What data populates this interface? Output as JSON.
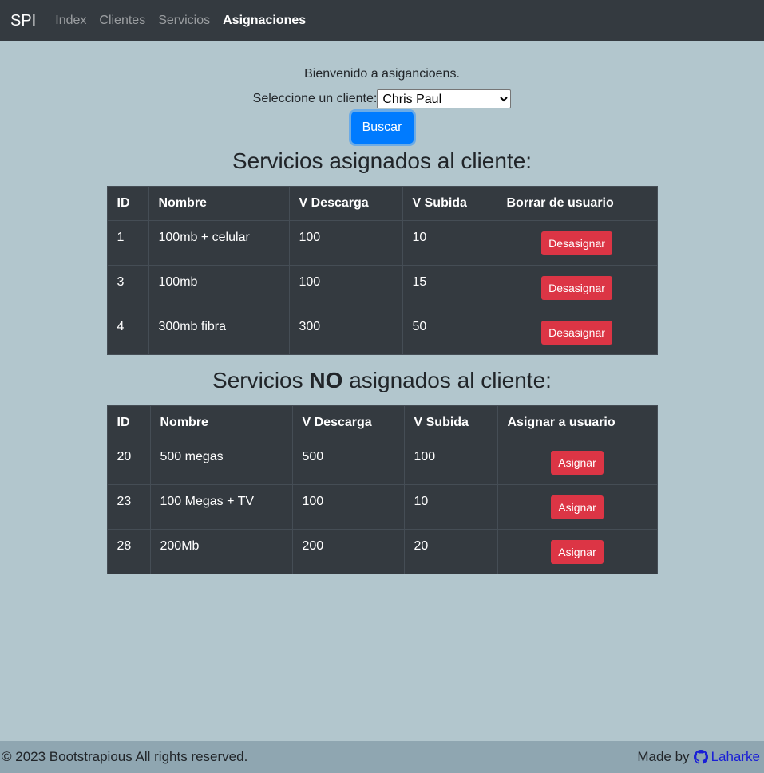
{
  "navbar": {
    "brand": "SPI",
    "links": [
      "Index",
      "Clientes",
      "Servicios",
      "Asignaciones"
    ],
    "active": "Asignaciones"
  },
  "main": {
    "welcome": "Bienvenido a asigancioens.",
    "select_label": "Seleccione un cliente:",
    "select_value": "Chris Paul",
    "search_button": "Buscar"
  },
  "assigned": {
    "heading": "Servicios asignados al cliente:",
    "columns": [
      "ID",
      "Nombre",
      "V Descarga",
      "V Subida",
      "Borrar de usuario"
    ],
    "action_label": "Desasignar",
    "rows": [
      {
        "id": "1",
        "nombre": "100mb + celular",
        "descarga": "100",
        "subida": "10"
      },
      {
        "id": "3",
        "nombre": "100mb",
        "descarga": "100",
        "subida": "15"
      },
      {
        "id": "4",
        "nombre": "300mb fibra",
        "descarga": "300",
        "subida": "50"
      }
    ]
  },
  "unassigned": {
    "heading_pre": "Servicios ",
    "heading_bold": "NO",
    "heading_post": " asignados al cliente:",
    "columns": [
      "ID",
      "Nombre",
      "V Descarga",
      "V Subida",
      "Asignar a usuario"
    ],
    "action_label": "Asignar",
    "rows": [
      {
        "id": "20",
        "nombre": "500 megas",
        "descarga": "500",
        "subida": "100"
      },
      {
        "id": "23",
        "nombre": "100 Megas + TV",
        "descarga": "100",
        "subida": "10"
      },
      {
        "id": "28",
        "nombre": "200Mb",
        "descarga": "200",
        "subida": "20"
      }
    ]
  },
  "footer": {
    "copyright": "© 2023 Bootstrapious All rights reserved.",
    "made_by": "Made by",
    "author": "Laharke",
    "icon": "github-icon"
  },
  "colors": {
    "page_bg": "#b2c6cd",
    "navbar_bg": "#343a40",
    "footer_bg": "#8fa6b1",
    "primary": "#007bff",
    "danger": "#dc3545",
    "link": "#1a1fd6"
  }
}
